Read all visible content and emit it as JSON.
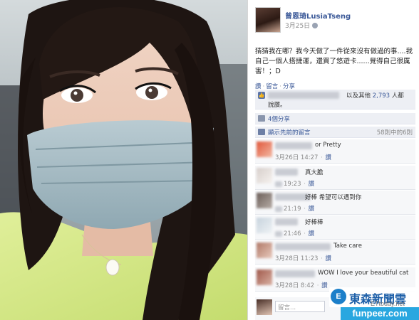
{
  "post": {
    "author": "曾恩琦LusiaTseng",
    "date": "3月25日",
    "text": "猜猜我在哪？我今天做了一件從來沒有做過的事....我自己一個人搭捷運，還買了悠遊卡......覺得自己很厲害！；D",
    "actions": [
      "讚",
      "留言",
      "分享"
    ],
    "likes_text": "以及其他",
    "likes_count": "2,793",
    "likes_suffix": "人都",
    "likes_line2": "說讚。",
    "shares": "4個分享",
    "prev_comments": "顯示先前的留言",
    "comments_count": "58則中的6則"
  },
  "comments": [
    {
      "text": "or Pretty",
      "date": "3月26日 14:27",
      "reply": "讚"
    },
    {
      "text": "真大膽",
      "date": "19:23",
      "reply": "讚"
    },
    {
      "text": "好棒  希望可以遇到你",
      "date": "21:19",
      "reply": "讚"
    },
    {
      "text": "好棒棒",
      "date": "21:46",
      "reply": "讚"
    },
    {
      "text": "Take care",
      "date": "3月28日 11:23",
      "reply": "讚"
    },
    {
      "text": "WOW I love your beautiful cat",
      "date": "3月28日 8:42",
      "reply": "讚"
    }
  ],
  "write_comment_placeholder": "留言...",
  "watermark": {
    "logo_char": "E",
    "brand": "東森新聞雲",
    "sub": "ETtoday.net",
    "site": "funpeer.com"
  },
  "icons": {
    "like": "thumbs-up-icon",
    "share": "share-icon",
    "prev": "comment-bubble-icon",
    "globe": "globe-icon"
  },
  "colors": {
    "facebook_blue": "#3b5998",
    "mask": "#9fb6c0",
    "sweater": "#d7e98a",
    "hair": "#201614"
  }
}
